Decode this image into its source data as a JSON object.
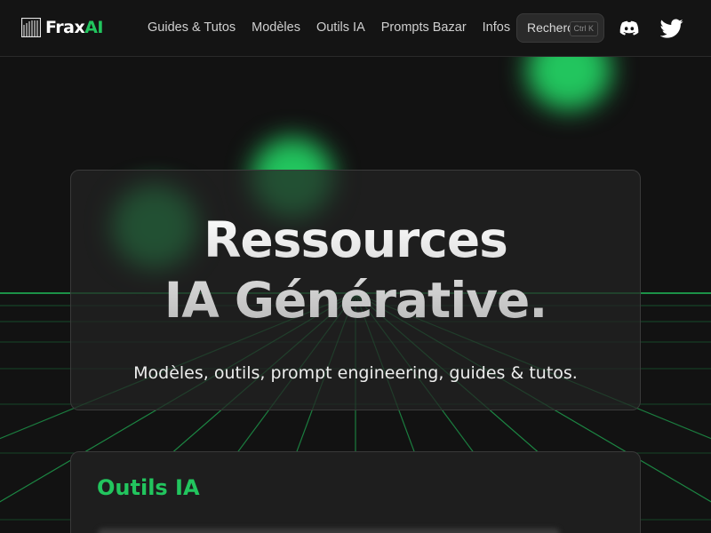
{
  "header": {
    "logo": {
      "text_main": "Frax",
      "text_accent": "AI",
      "icon": "stripes-logo-icon"
    },
    "nav": [
      {
        "label": "Guides & Tutos"
      },
      {
        "label": "Modèles"
      },
      {
        "label": "Outils IA"
      },
      {
        "label": "Prompts Bazar"
      },
      {
        "label": "Infos"
      }
    ],
    "search": {
      "label": "Rechercher",
      "shortcut": "Ctrl K"
    },
    "social": [
      {
        "name": "discord-icon"
      },
      {
        "name": "twitter-icon"
      }
    ]
  },
  "hero": {
    "title_line1": "Ressources",
    "title_line2": "IA Générative.",
    "subtitle": "Modèles, outils, prompt engineering, guides & tutos."
  },
  "tools_section": {
    "title": "Outils IA"
  },
  "colors": {
    "accent": "#22c55e",
    "background": "#121212",
    "card": "#222222",
    "grid_line": "#22c55e"
  }
}
